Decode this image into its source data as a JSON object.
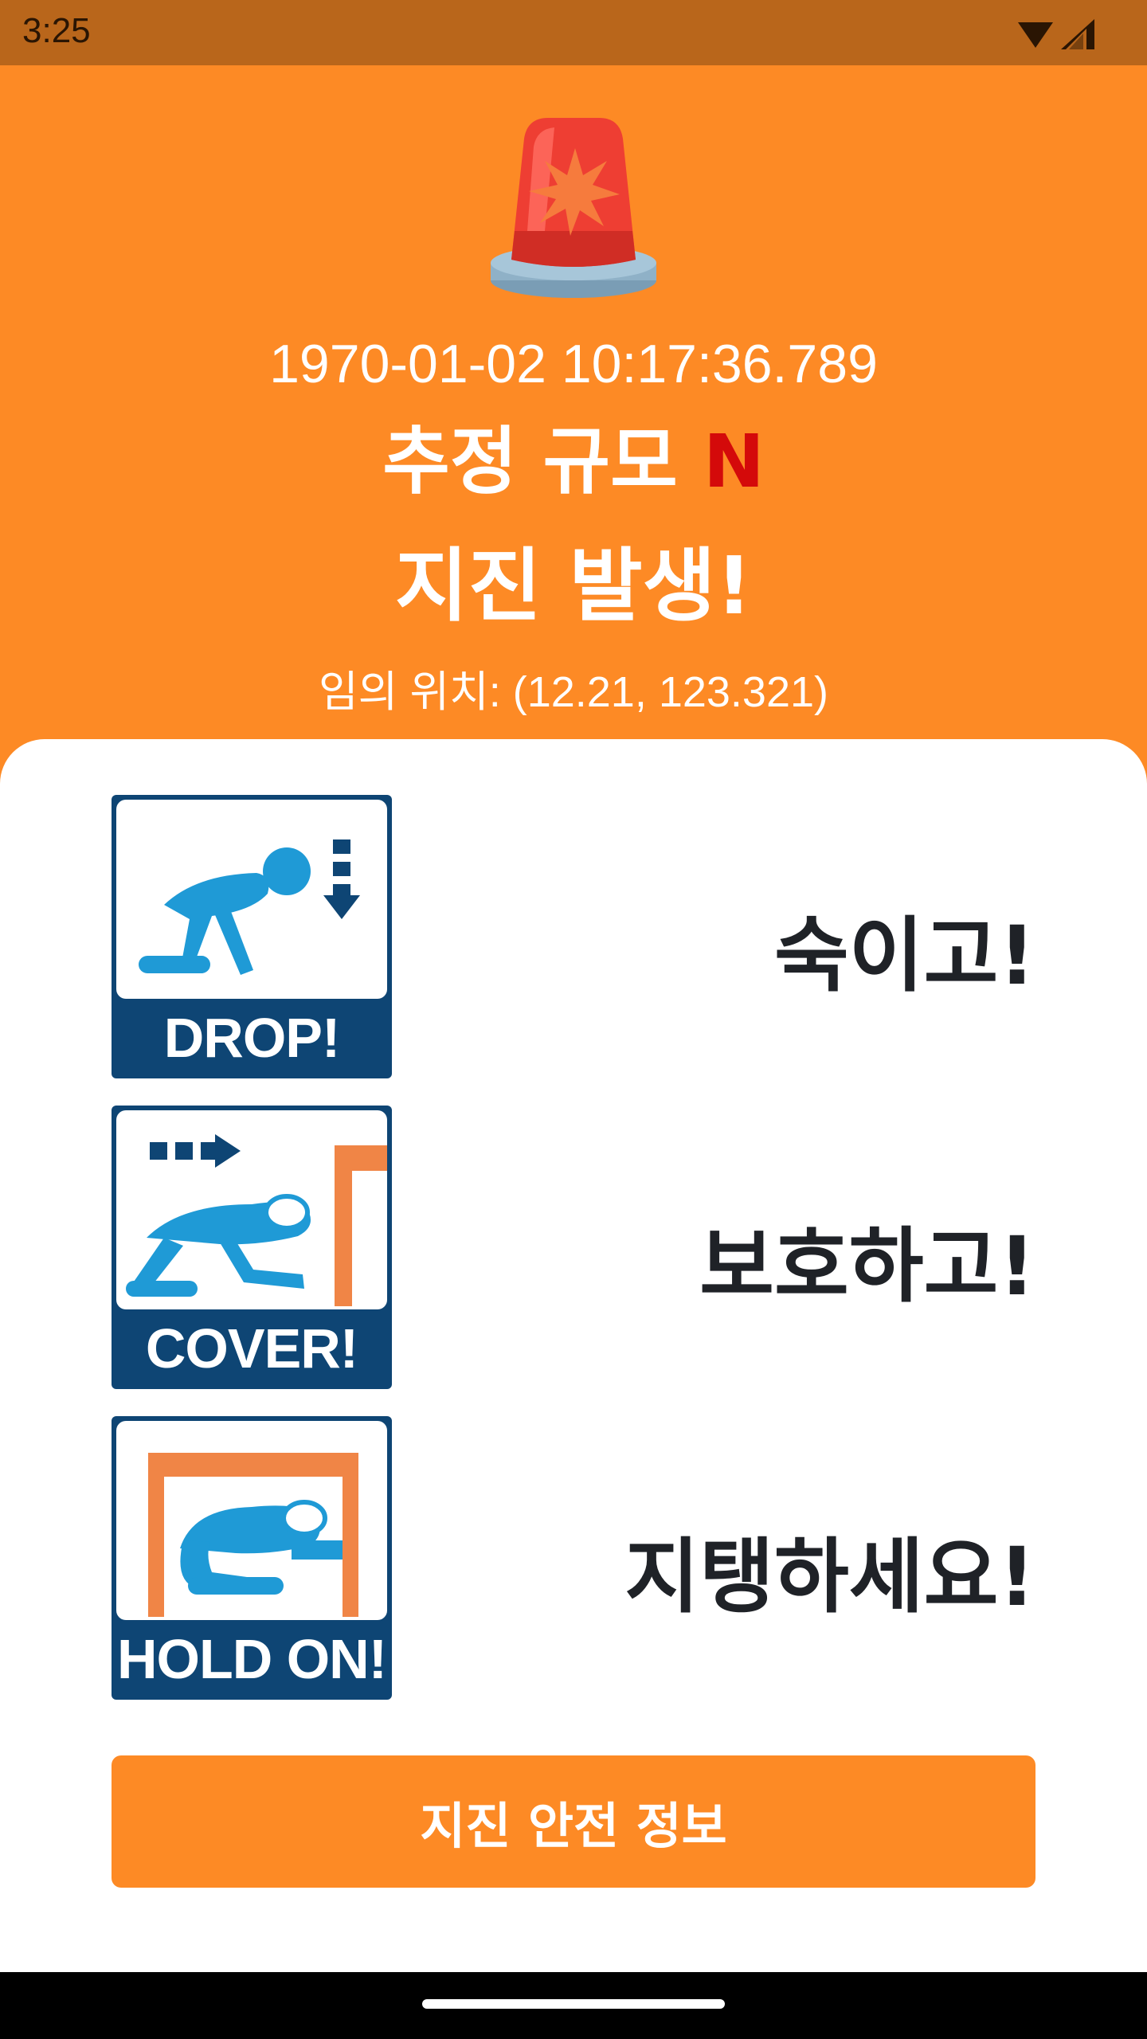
{
  "status_bar": {
    "time": "3:25",
    "icons": [
      "wifi-icon",
      "signal-icon"
    ]
  },
  "alert": {
    "icon": "siren-icon",
    "timestamp": "1970-01-02 10:17:36.789",
    "magnitude_label": "추정 규모",
    "magnitude_value": "N",
    "headline": "지진 발생!",
    "location": "임의 위치: (12.21, 123.321)"
  },
  "steps": [
    {
      "icon": "drop-pictogram-icon",
      "badge": "DROP!",
      "text": "숙이고!"
    },
    {
      "icon": "cover-pictogram-icon",
      "badge": "COVER!",
      "text": "보호하고!"
    },
    {
      "icon": "hold-on-pictogram-icon",
      "badge": "HOLD ON!",
      "text": "지탱하세요!"
    }
  ],
  "info_button": {
    "label": "지진 안전 정보"
  },
  "colors": {
    "accent": "#fd8a25",
    "status_bar": "#b9661b",
    "magnitude_value": "#d40a0a",
    "pictogram_navy": "#0e4574",
    "figure_blue": "#1f9ad6",
    "furniture_orange": "#f08546"
  }
}
